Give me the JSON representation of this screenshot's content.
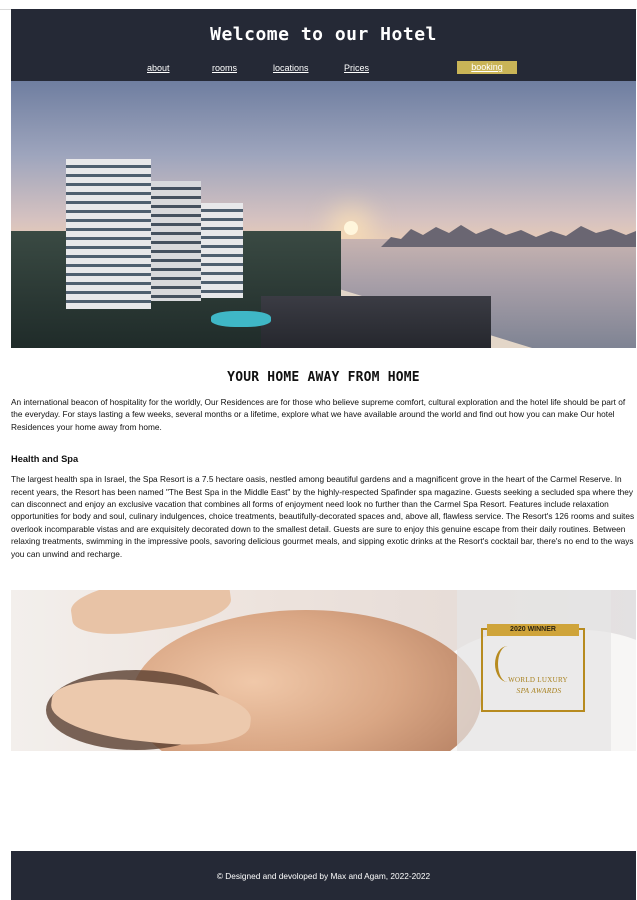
{
  "header": {
    "title": "Welcome to our Hotel",
    "nav": [
      {
        "label": "about"
      },
      {
        "label": "rooms"
      },
      {
        "label": "locations"
      },
      {
        "label": "Prices"
      },
      {
        "label": "booking"
      }
    ]
  },
  "hero": {
    "image": "hotel-beach-sunset-image"
  },
  "main": {
    "title": "YOUR HOME AWAY FROM HOME",
    "intro": "An international beacon of hospitality for the worldly, Our Residences are for those who believe supreme comfort, cultural exploration and the hotel life should be part of the everyday. For stays lasting a few weeks, several months or a lifetime, explore what we have available around the world and find out how you can make Our hotel Residences your home away from home.",
    "spa_heading": "Health and Spa",
    "spa_text": "The largest health spa in Israel, the Spa Resort is a 7.5 hectare oasis, nestled among beautiful gardens and a magnificent grove in the heart of the Carmel Reserve. In recent years, the Resort has been named \"The Best Spa in the Middle East\" by the highly-respected Spafinder spa magazine. Guests seeking a secluded spa where they can disconnect and enjoy an exclusive vacation that combines all forms of enjoyment need look no further than the Carmel Spa Resort. Features include relaxation opportunities for body and soul, culinary indulgences, choice treatments, beautifully-decorated spaces and, above all, flawless service. The Resort's 126 rooms and suites overlook incomparable vistas and are exquisitely decorated down to the smallest detail. Guests are sure to enjoy this genuine escape from their daily routines. Between relaxing treatments, swimming in the impressive pools, savoring delicious gourmet meals, and sipping exotic drinks at the Resort's cocktail bar, there's no end to the ways you can unwind and recharge."
  },
  "spa_image": {
    "award_ribbon": "2020 WINNER",
    "award_line1": "WORLD LUXURY",
    "award_line2": "SPA AWARDS"
  },
  "footer": {
    "text": "© Designed and devoloped by Max and Agam, 2022-2022"
  },
  "colors": {
    "header_bg": "#252936",
    "booking_bg": "#c9b457",
    "text": "#111111"
  }
}
